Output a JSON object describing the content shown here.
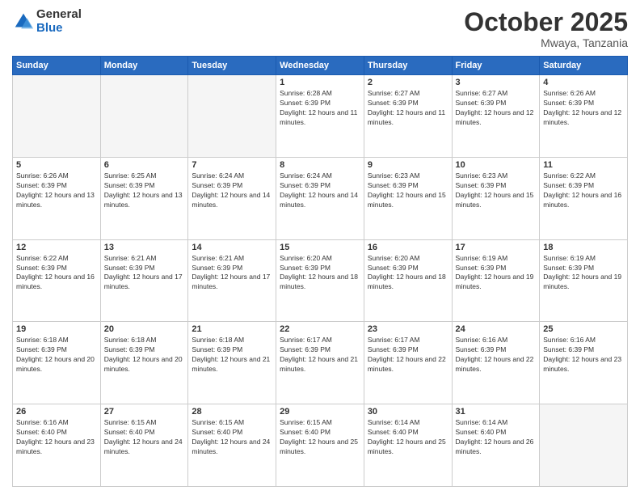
{
  "logo": {
    "general": "General",
    "blue": "Blue"
  },
  "title": "October 2025",
  "location": "Mwaya, Tanzania",
  "days_of_week": [
    "Sunday",
    "Monday",
    "Tuesday",
    "Wednesday",
    "Thursday",
    "Friday",
    "Saturday"
  ],
  "weeks": [
    [
      {
        "day": "",
        "text": ""
      },
      {
        "day": "",
        "text": ""
      },
      {
        "day": "",
        "text": ""
      },
      {
        "day": "1",
        "text": "Sunrise: 6:28 AM\nSunset: 6:39 PM\nDaylight: 12 hours and 11 minutes."
      },
      {
        "day": "2",
        "text": "Sunrise: 6:27 AM\nSunset: 6:39 PM\nDaylight: 12 hours and 11 minutes."
      },
      {
        "day": "3",
        "text": "Sunrise: 6:27 AM\nSunset: 6:39 PM\nDaylight: 12 hours and 12 minutes."
      },
      {
        "day": "4",
        "text": "Sunrise: 6:26 AM\nSunset: 6:39 PM\nDaylight: 12 hours and 12 minutes."
      }
    ],
    [
      {
        "day": "5",
        "text": "Sunrise: 6:26 AM\nSunset: 6:39 PM\nDaylight: 12 hours and 13 minutes."
      },
      {
        "day": "6",
        "text": "Sunrise: 6:25 AM\nSunset: 6:39 PM\nDaylight: 12 hours and 13 minutes."
      },
      {
        "day": "7",
        "text": "Sunrise: 6:24 AM\nSunset: 6:39 PM\nDaylight: 12 hours and 14 minutes."
      },
      {
        "day": "8",
        "text": "Sunrise: 6:24 AM\nSunset: 6:39 PM\nDaylight: 12 hours and 14 minutes."
      },
      {
        "day": "9",
        "text": "Sunrise: 6:23 AM\nSunset: 6:39 PM\nDaylight: 12 hours and 15 minutes."
      },
      {
        "day": "10",
        "text": "Sunrise: 6:23 AM\nSunset: 6:39 PM\nDaylight: 12 hours and 15 minutes."
      },
      {
        "day": "11",
        "text": "Sunrise: 6:22 AM\nSunset: 6:39 PM\nDaylight: 12 hours and 16 minutes."
      }
    ],
    [
      {
        "day": "12",
        "text": "Sunrise: 6:22 AM\nSunset: 6:39 PM\nDaylight: 12 hours and 16 minutes."
      },
      {
        "day": "13",
        "text": "Sunrise: 6:21 AM\nSunset: 6:39 PM\nDaylight: 12 hours and 17 minutes."
      },
      {
        "day": "14",
        "text": "Sunrise: 6:21 AM\nSunset: 6:39 PM\nDaylight: 12 hours and 17 minutes."
      },
      {
        "day": "15",
        "text": "Sunrise: 6:20 AM\nSunset: 6:39 PM\nDaylight: 12 hours and 18 minutes."
      },
      {
        "day": "16",
        "text": "Sunrise: 6:20 AM\nSunset: 6:39 PM\nDaylight: 12 hours and 18 minutes."
      },
      {
        "day": "17",
        "text": "Sunrise: 6:19 AM\nSunset: 6:39 PM\nDaylight: 12 hours and 19 minutes."
      },
      {
        "day": "18",
        "text": "Sunrise: 6:19 AM\nSunset: 6:39 PM\nDaylight: 12 hours and 19 minutes."
      }
    ],
    [
      {
        "day": "19",
        "text": "Sunrise: 6:18 AM\nSunset: 6:39 PM\nDaylight: 12 hours and 20 minutes."
      },
      {
        "day": "20",
        "text": "Sunrise: 6:18 AM\nSunset: 6:39 PM\nDaylight: 12 hours and 20 minutes."
      },
      {
        "day": "21",
        "text": "Sunrise: 6:18 AM\nSunset: 6:39 PM\nDaylight: 12 hours and 21 minutes."
      },
      {
        "day": "22",
        "text": "Sunrise: 6:17 AM\nSunset: 6:39 PM\nDaylight: 12 hours and 21 minutes."
      },
      {
        "day": "23",
        "text": "Sunrise: 6:17 AM\nSunset: 6:39 PM\nDaylight: 12 hours and 22 minutes."
      },
      {
        "day": "24",
        "text": "Sunrise: 6:16 AM\nSunset: 6:39 PM\nDaylight: 12 hours and 22 minutes."
      },
      {
        "day": "25",
        "text": "Sunrise: 6:16 AM\nSunset: 6:39 PM\nDaylight: 12 hours and 23 minutes."
      }
    ],
    [
      {
        "day": "26",
        "text": "Sunrise: 6:16 AM\nSunset: 6:40 PM\nDaylight: 12 hours and 23 minutes."
      },
      {
        "day": "27",
        "text": "Sunrise: 6:15 AM\nSunset: 6:40 PM\nDaylight: 12 hours and 24 minutes."
      },
      {
        "day": "28",
        "text": "Sunrise: 6:15 AM\nSunset: 6:40 PM\nDaylight: 12 hours and 24 minutes."
      },
      {
        "day": "29",
        "text": "Sunrise: 6:15 AM\nSunset: 6:40 PM\nDaylight: 12 hours and 25 minutes."
      },
      {
        "day": "30",
        "text": "Sunrise: 6:14 AM\nSunset: 6:40 PM\nDaylight: 12 hours and 25 minutes."
      },
      {
        "day": "31",
        "text": "Sunrise: 6:14 AM\nSunset: 6:40 PM\nDaylight: 12 hours and 26 minutes."
      },
      {
        "day": "",
        "text": ""
      }
    ]
  ]
}
